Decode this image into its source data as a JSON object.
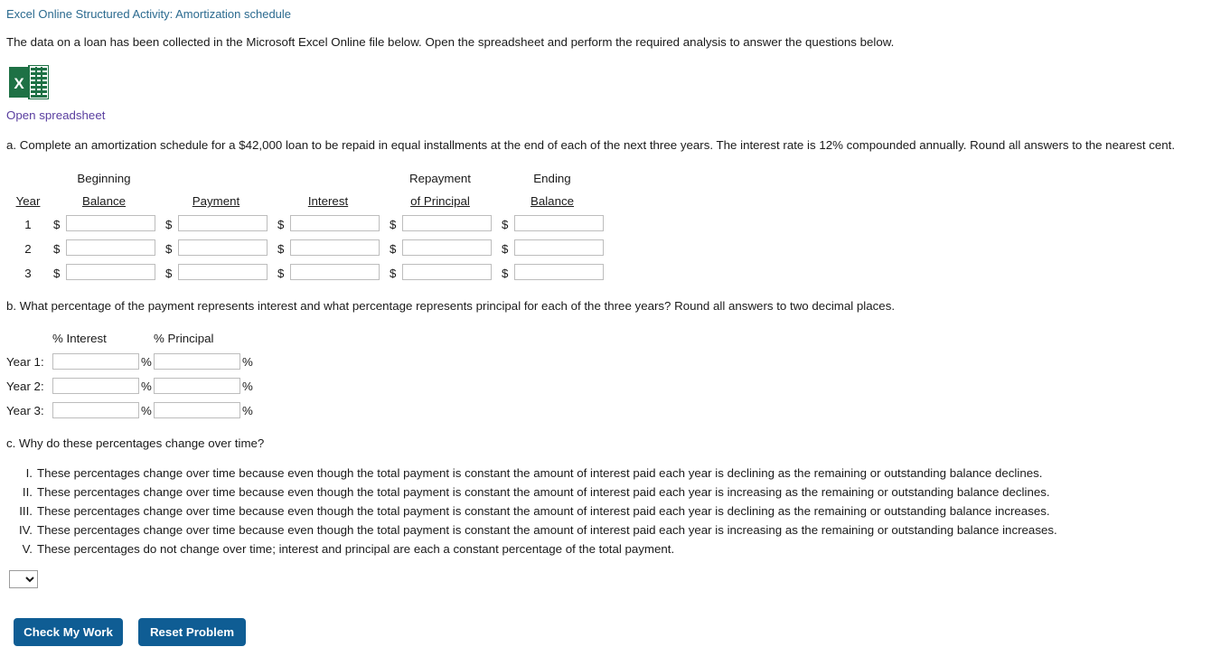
{
  "header": {
    "activity_title": "Excel Online Structured Activity: Amortization schedule",
    "intro": "The data on a loan has been collected in the Microsoft Excel Online file below. Open the spreadsheet and perform the required analysis to answer the questions below.",
    "excel_icon": "excel-file-icon",
    "excel_icon_letter": "X",
    "open_link": "Open spreadsheet"
  },
  "question_a": {
    "prompt": "a. Complete an amortization schedule for a $42,000 loan to be repaid in equal installments at the end of each of the next three years. The interest rate is 12% compounded annually. Round all answers to the nearest cent.",
    "headers_top": [
      "",
      "Beginning",
      "",
      "",
      "Repayment",
      "Ending"
    ],
    "headers_bottom": [
      "Year",
      "Balance",
      "Payment",
      "Interest",
      "of Principal",
      "Balance"
    ],
    "currency_symbol": "$",
    "rows": [
      {
        "year": "1",
        "beginning_balance": "",
        "payment": "",
        "interest": "",
        "repayment_of_principal": "",
        "ending_balance": ""
      },
      {
        "year": "2",
        "beginning_balance": "",
        "payment": "",
        "interest": "",
        "repayment_of_principal": "",
        "ending_balance": ""
      },
      {
        "year": "3",
        "beginning_balance": "",
        "payment": "",
        "interest": "",
        "repayment_of_principal": "",
        "ending_balance": ""
      }
    ]
  },
  "question_b": {
    "prompt": "b. What percentage of the payment represents interest and what percentage represents principal for each of the three years? Round all answers to two decimal places.",
    "headers": [
      "% Interest",
      "% Principal"
    ],
    "percent_symbol": "%",
    "rows": [
      {
        "label": "Year 1:",
        "interest": "",
        "principal": ""
      },
      {
        "label": "Year 2:",
        "interest": "",
        "principal": ""
      },
      {
        "label": "Year 3:",
        "interest": "",
        "principal": ""
      }
    ]
  },
  "question_c": {
    "prompt": "c. Why do these percentages change over time?",
    "options": [
      {
        "numeral": "I.",
        "text": "These percentages change over time because even though the total payment is constant the amount of interest paid each year is declining as the remaining or outstanding balance declines."
      },
      {
        "numeral": "II.",
        "text": "These percentages change over time because even though the total payment is constant the amount of interest paid each year is increasing as the remaining or outstanding balance declines."
      },
      {
        "numeral": "III.",
        "text": "These percentages change over time because even though the total payment is constant the amount of interest paid each year is declining as the remaining or outstanding balance increases."
      },
      {
        "numeral": "IV.",
        "text": "These percentages change over time because even though the total payment is constant the amount of interest paid each year is increasing as the remaining or outstanding balance increases."
      },
      {
        "numeral": "V.",
        "text": "These percentages do not change over time; interest and principal are each a constant percentage of the total payment."
      }
    ],
    "select": {
      "selected": "",
      "options": [
        "",
        "I",
        "II",
        "III",
        "IV",
        "V"
      ]
    }
  },
  "footer": {
    "check_label": "Check My Work",
    "reset_label": "Reset Problem"
  },
  "colors": {
    "title_link": "#2b6a8f",
    "open_link": "#5a3fa0",
    "button_bg": "#0f5d94",
    "excel_green": "#1e7145",
    "excel_green_light": "#21a366"
  }
}
